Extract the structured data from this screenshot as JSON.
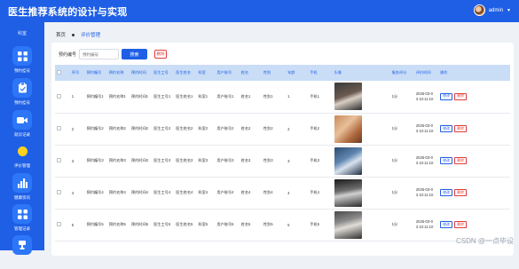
{
  "header": {
    "title": "医生推荐系统的设计与实现",
    "user": "admin"
  },
  "sidebar": {
    "title": "科室",
    "items": [
      {
        "label": "预约挂号",
        "icon": "grid-icon"
      },
      {
        "label": "预约挂号",
        "icon": "clipboard-icon"
      },
      {
        "label": "就诊记录",
        "icon": "camera-icon"
      },
      {
        "label": "评价管理",
        "icon": "bulb-icon",
        "active": true
      },
      {
        "label": "健康资讯",
        "icon": "bar-chart-icon"
      },
      {
        "label": "管理记录",
        "icon": "grid-icon"
      }
    ]
  },
  "breadcrumb": {
    "home": "首页",
    "current": "评价管理"
  },
  "search": {
    "label": "预约编号",
    "placeholder": "预约编号",
    "button": "搜索",
    "delete": "删除"
  },
  "table": {
    "headers": [
      "",
      "序号",
      "预约编号",
      "预约名称",
      "预约时间",
      "医生工号",
      "医生姓名",
      "科室",
      "用户账号",
      "姓名",
      "性别",
      "年龄",
      "手机",
      "头像",
      "服务评分",
      "评价时间",
      "操作"
    ],
    "rows": [
      {
        "index": "1",
        "code": "预约编号1",
        "name": "预约名称1",
        "time": "预约时间1",
        "docno": "医生工号1",
        "docname": "医生姓名1",
        "dept": "科室1",
        "account": "用户账号1",
        "uname": "姓名1",
        "gender": "性别1",
        "age": "1",
        "phone": "手机1",
        "score": "1分",
        "date": "2025-03-0",
        "date2": "3 10:11:10"
      },
      {
        "index": "2",
        "code": "预约编号2",
        "name": "预约名称2",
        "time": "预约时间2",
        "docno": "医生工号2",
        "docname": "医生姓名2",
        "dept": "科室2",
        "account": "用户账号2",
        "uname": "姓名2",
        "gender": "性别2",
        "age": "2",
        "phone": "手机2",
        "score": "1分",
        "date": "2025-03-0",
        "date2": "3 10:11:10"
      },
      {
        "index": "3",
        "code": "预约编号3",
        "name": "预约名称3",
        "time": "预约时间3",
        "docno": "医生工号3",
        "docname": "医生姓名3",
        "dept": "科室3",
        "account": "用户账号3",
        "uname": "姓名3",
        "gender": "性别3",
        "age": "3",
        "phone": "手机3",
        "score": "1分",
        "date": "2025-03-0",
        "date2": "3 10:11:10"
      },
      {
        "index": "4",
        "code": "预约编号4",
        "name": "预约名称4",
        "time": "预约时间4",
        "docno": "医生工号4",
        "docname": "医生姓名4",
        "dept": "科室4",
        "account": "用户账号4",
        "uname": "姓名4",
        "gender": "性别4",
        "age": "4",
        "phone": "手机4",
        "score": "1分",
        "date": "2025-03-0",
        "date2": "3 10:11:10"
      },
      {
        "index": "5",
        "code": "预约编号5",
        "name": "预约名称5",
        "time": "预约时间5",
        "docno": "医生工号5",
        "docname": "医生姓名5",
        "dept": "科室5",
        "account": "用户账号5",
        "uname": "姓名5",
        "gender": "性别5",
        "age": "5",
        "phone": "手机5",
        "score": "1分",
        "date": "2025-03-0",
        "date2": "3 10:11:10"
      }
    ],
    "edit_label": "修改",
    "delete_label": "删除"
  },
  "watermark": "CSDN @一点毕设",
  "colors": {
    "primary": "#1e5fe6",
    "danger": "#e03b3b",
    "header_row": "#c9ddf7"
  }
}
